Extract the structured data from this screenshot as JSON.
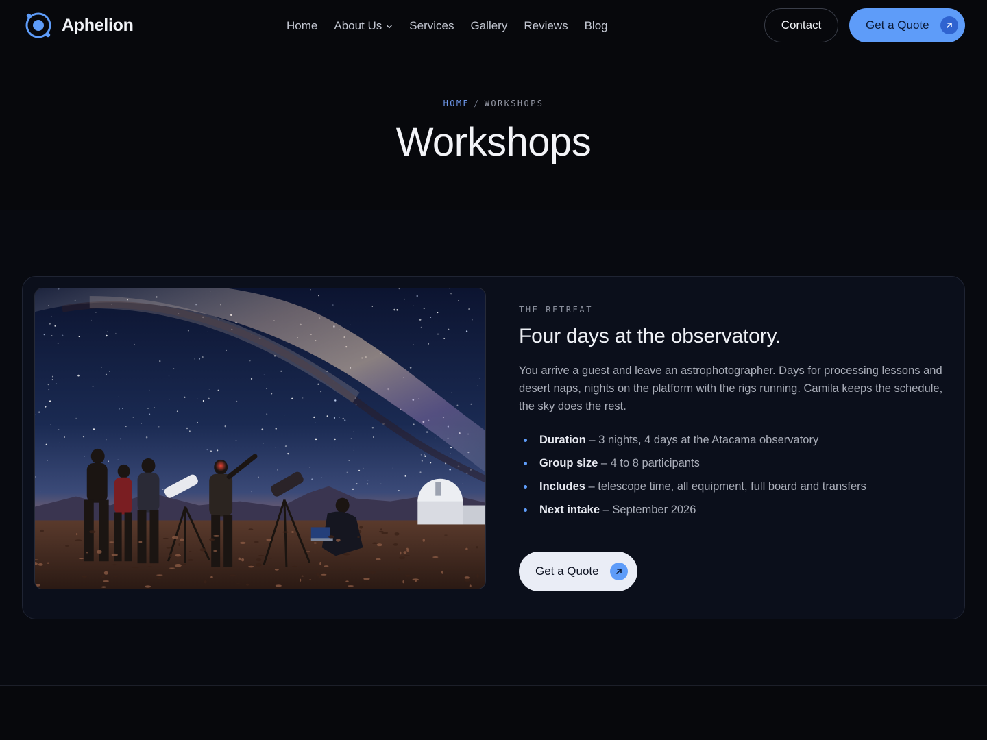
{
  "brand": {
    "name": "Aphelion",
    "logo_icon": "orbit-logo-icon"
  },
  "nav": {
    "items": [
      {
        "label": "Home"
      },
      {
        "label": "About Us",
        "has_dropdown": true
      },
      {
        "label": "Services"
      },
      {
        "label": "Gallery"
      },
      {
        "label": "Reviews"
      },
      {
        "label": "Blog"
      }
    ],
    "contact_label": "Contact",
    "quote_label": "Get a Quote"
  },
  "breadcrumb": {
    "home": "HOME",
    "separator": "/",
    "current": "WORKSHOPS"
  },
  "page_title": "Workshops",
  "retreat": {
    "image_subject": "milky-way-observatory-photo",
    "eyebrow": "THE RETREAT",
    "title": "Four days at the observatory.",
    "body": "You arrive a guest and leave an astrophotographer. Days for processing lessons and desert naps, nights on the platform with the rigs running. Camila keeps the schedule, the sky does the rest.",
    "facts": [
      {
        "key": "Duration",
        "value": " – 3 nights, 4 days at the Atacama observatory"
      },
      {
        "key": "Group size",
        "value": " – 4 to 8 participants"
      },
      {
        "key": "Includes",
        "value": " – telescope time, all equipment, full board and transfers"
      },
      {
        "key": "Next intake",
        "value": " – September 2026"
      }
    ],
    "cta_label": "Get a Quote"
  },
  "colors": {
    "background": "#07080c",
    "card": "#0b0f1b",
    "accent": "#5e9cf9",
    "text": "#e6e8ef",
    "muted": "#a9adb8"
  }
}
